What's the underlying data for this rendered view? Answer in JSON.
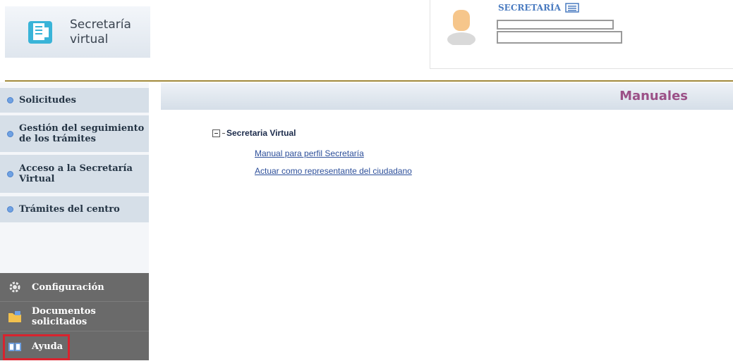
{
  "logo": {
    "line1": "Secretaría",
    "line2": "virtual",
    "icon": "document-icon"
  },
  "user": {
    "role": "SECRETARÍA",
    "role_icon": "list-icon"
  },
  "sidebar": {
    "items": [
      {
        "label": "Solicitudes"
      },
      {
        "label": "Gestión del seguimiento de los trámites"
      },
      {
        "label": "Acceso a la Secretaría Virtual"
      },
      {
        "label": "Trámites del centro"
      }
    ]
  },
  "bottom_menu": {
    "items": [
      {
        "label": "Configuración",
        "icon": "gear-icon"
      },
      {
        "label": "Documentos solicitados",
        "icon": "folder-icon"
      },
      {
        "label": "Ayuda",
        "icon": "book-icon"
      }
    ]
  },
  "page": {
    "title": "Manuales"
  },
  "tree": {
    "root_label": "Secretaria Virtual",
    "links": [
      "Manual para perfil Secretaría ",
      "Actuar como representante del ciudadano "
    ]
  },
  "colors": {
    "accent_title": "#9b5087",
    "link": "#2d4f9a",
    "highlight": "#d9232e",
    "rule": "#a28a3b"
  }
}
